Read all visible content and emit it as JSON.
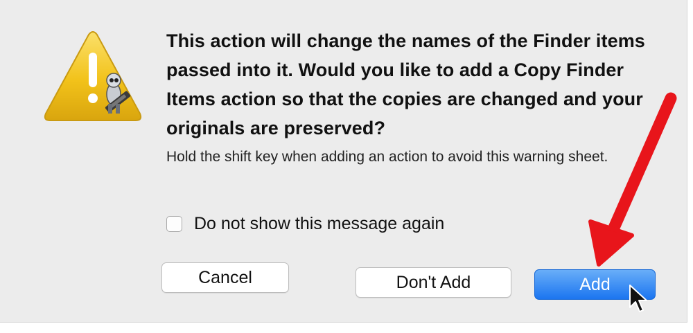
{
  "dialog": {
    "icon": "automator-warning-icon",
    "title": "This action will change the names of the Finder items passed into it.  Would you like to add a Copy Finder Items action so that the copies are changed and your originals are preserved?",
    "info": "Hold the shift key when adding an action to avoid this warning sheet.",
    "checkbox_label": "Do not show this message again",
    "checkbox_checked": false
  },
  "buttons": {
    "cancel": "Cancel",
    "dont_add": "Don't Add",
    "add": "Add"
  },
  "colors": {
    "dialog_bg": "#ececec",
    "default_button": "#1b75f0",
    "annotation_arrow": "#e8151b",
    "warning_triangle": "#f5c518"
  }
}
